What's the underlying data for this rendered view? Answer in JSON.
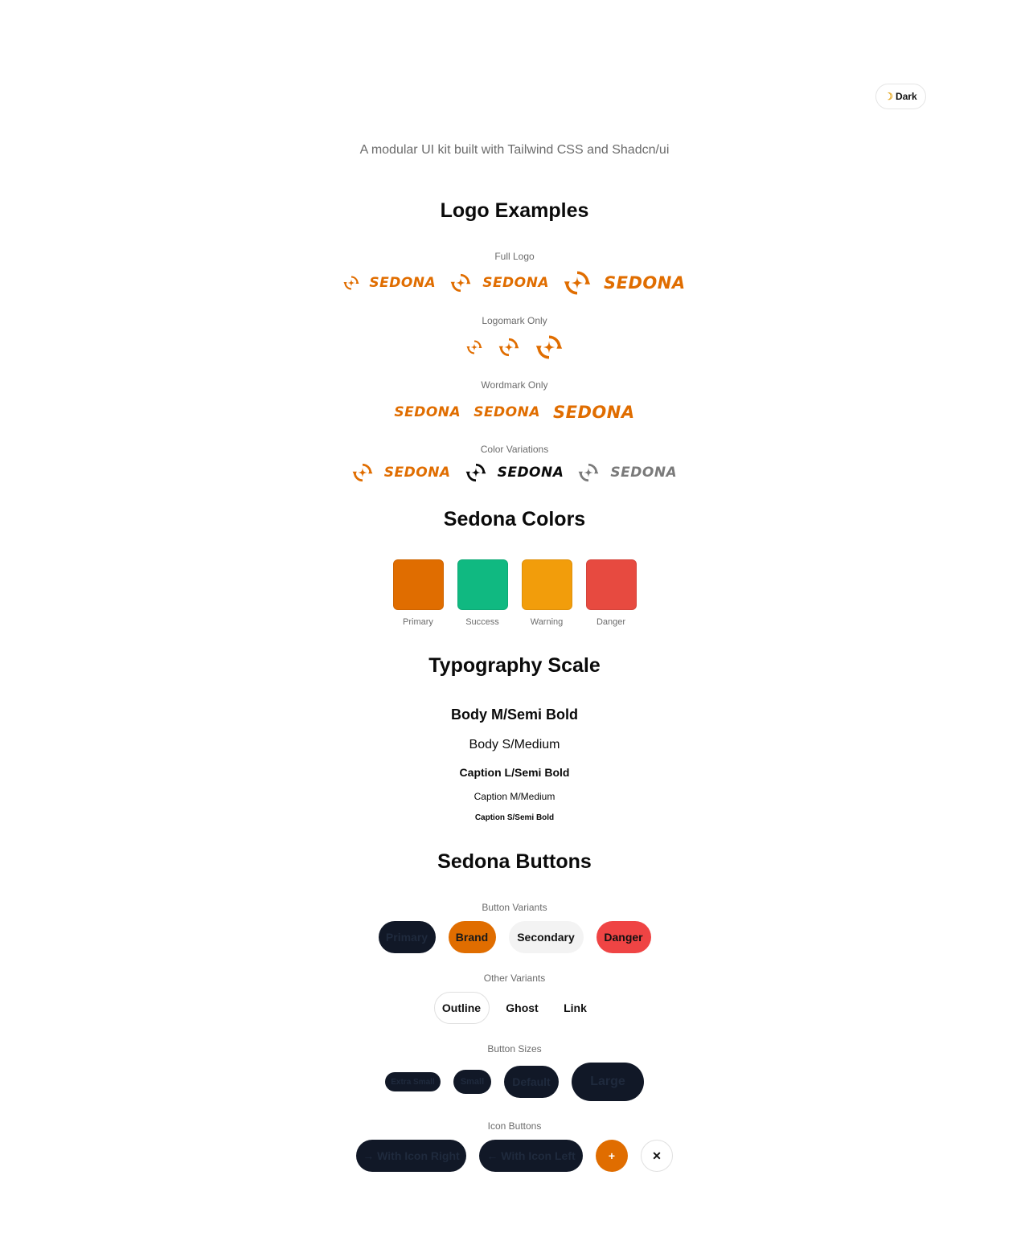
{
  "theme_toggle": {
    "icon": "moon-icon",
    "label": "Dark"
  },
  "subtitle": "A modular UI kit built with Tailwind CSS and Shadcn/ui",
  "logo_section": {
    "title": "Logo Examples",
    "full_logo_label": "Full Logo",
    "logomark_label": "Logomark Only",
    "wordmark_label": "Wordmark Only",
    "color_variations_label": "Color Variations",
    "brand_word": "SEDONA"
  },
  "colors_section": {
    "title": "Sedona Colors",
    "swatches": [
      {
        "label": "Primary",
        "color": "#e06d00"
      },
      {
        "label": "Success",
        "color": "#10b981"
      },
      {
        "label": "Warning",
        "color": "#f29d0b"
      },
      {
        "label": "Danger",
        "color": "#e74a40"
      }
    ]
  },
  "typography_section": {
    "title": "Typography Scale",
    "samples": [
      "Body M/Semi Bold",
      "Body S/Medium",
      "Caption L/Semi Bold",
      "Caption M/Medium",
      "Caption S/Semi Bold"
    ]
  },
  "buttons_section": {
    "title": "Sedona Buttons",
    "variants_label": "Button Variants",
    "variants": [
      "Primary",
      "Brand",
      "Secondary",
      "Danger"
    ],
    "other_label": "Other Variants",
    "other": [
      "Outline",
      "Ghost",
      "Link"
    ],
    "sizes_label": "Button Sizes",
    "sizes": [
      "Extra Small",
      "Small",
      "Default",
      "Large"
    ],
    "icon_label": "Icon Buttons",
    "icon_right": "→ With Icon Right",
    "icon_left": "← With Icon Left",
    "plus_icon": "plus-icon",
    "close_icon": "close-icon"
  },
  "colors": {
    "brand": "#e06d00",
    "dark": "#111827"
  }
}
